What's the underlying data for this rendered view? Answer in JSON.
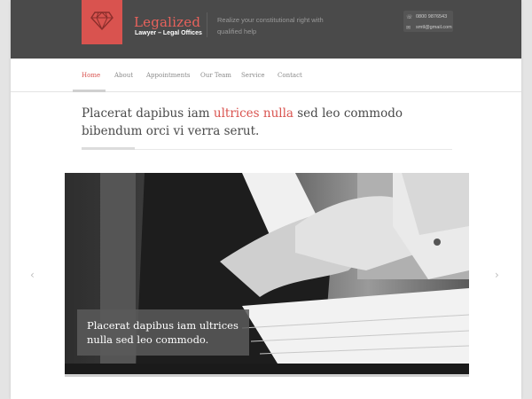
{
  "header": {
    "brand_name": "Legalized",
    "brand_subtitle": "Lawyer – Legal Offices",
    "tagline": "Realize your constitutional right with qualified help",
    "phone": "0800 9876543",
    "email": "smtl@gmail.com",
    "logo_icon": "diamond-icon",
    "brand_color": "#d9534f"
  },
  "nav": {
    "items": [
      {
        "label": "Home",
        "active": true
      },
      {
        "label": "About"
      },
      {
        "label": "Appointments"
      },
      {
        "label": "Our Team"
      },
      {
        "label": "Service"
      },
      {
        "label": "Contact"
      }
    ]
  },
  "intro": {
    "text_before": "Placerat dapibus iam ",
    "highlight": "ultrices nulla",
    "text_after": " sed leo commodo bibendum orci vi verra serut."
  },
  "slider": {
    "image_description": "handshake",
    "caption": "Placerat dapibus iam ultrices nulla sed leo commodo.",
    "prev_icon": "chevron-left-icon",
    "next_icon": "chevron-right-icon"
  }
}
